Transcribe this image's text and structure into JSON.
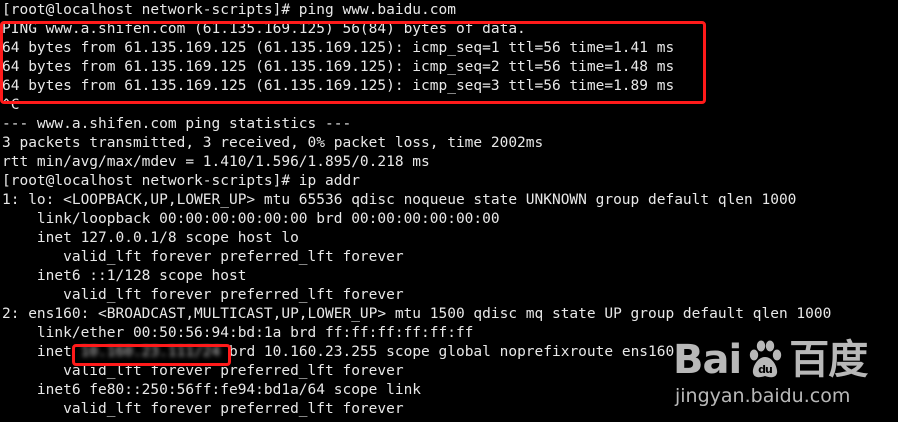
{
  "terminal": {
    "lines": [
      "[root@localhost network-scripts]# ping www.baidu.com",
      "PING www.a.shifen.com (61.135.169.125) 56(84) bytes of data.",
      "64 bytes from 61.135.169.125 (61.135.169.125): icmp_seq=1 ttl=56 time=1.41 ms",
      "64 bytes from 61.135.169.125 (61.135.169.125): icmp_seq=2 ttl=56 time=1.48 ms",
      "64 bytes from 61.135.169.125 (61.135.169.125): icmp_seq=3 ttl=56 time=1.89 ms",
      "^C",
      "--- www.a.shifen.com ping statistics ---",
      "3 packets transmitted, 3 received, 0% packet loss, time 2002ms",
      "rtt min/avg/max/mdev = 1.410/1.596/1.895/0.218 ms",
      "[root@localhost network-scripts]# ip addr",
      "1: lo: <LOOPBACK,UP,LOWER_UP> mtu 65536 qdisc noqueue state UNKNOWN group default qlen 1000",
      "    link/loopback 00:00:00:00:00:00 brd 00:00:00:00:00:00",
      "    inet 127.0.0.1/8 scope host lo",
      "       valid_lft forever preferred_lft forever",
      "    inet6 ::1/128 scope host",
      "       valid_lft forever preferred_lft forever",
      "2: ens160: <BROADCAST,MULTICAST,UP,LOWER_UP> mtu 1500 qdisc mq state UP group default qlen 1000",
      "    link/ether 00:50:56:94:bd:1a brd ff:ff:ff:ff:ff:ff"
    ],
    "inet_line": {
      "prefix": "    inet ",
      "masked_address": "10.160.23.111/24",
      "suffix": " brd 10.160.23.255 scope global noprefixroute ens160"
    },
    "tail_lines": [
      "       valid_lft forever preferred_lft forever",
      "    inet6 fe80::250:56ff:fe94:bd1a/64 scope link",
      "       valid_lft forever preferred_lft forever"
    ]
  },
  "watermark": {
    "logo_left": "Bai",
    "logo_right": "百度",
    "paw_icon": "paw-icon",
    "subtitle": "jingyan.baidu.com"
  },
  "colors": {
    "background": "#000000",
    "text": "#e8e8e8",
    "highlight": "#ff1a1a"
  }
}
